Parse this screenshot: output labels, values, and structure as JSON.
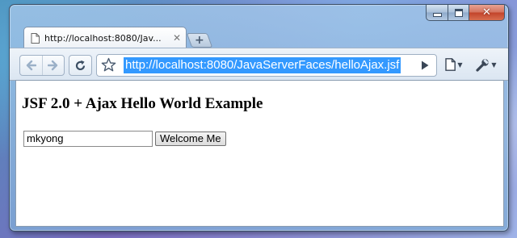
{
  "window": {
    "caption_buttons": {
      "minimize_icon": "minimize-icon",
      "maximize_icon": "maximize-icon",
      "close_icon": "close-icon"
    }
  },
  "tabs": [
    {
      "title": "http://localhost:8080/Jav...",
      "close_glyph": "✕",
      "icon": "page-icon"
    }
  ],
  "new_tab_glyph": "+",
  "toolbar": {
    "back_icon": "back-arrow-icon",
    "forward_icon": "forward-arrow-icon",
    "reload_icon": "reload-icon",
    "bookmark_icon": "star-icon",
    "url": "http://localhost:8080/JavaServerFaces/helloAjax.jsf",
    "go_icon": "play-icon",
    "page_menu_icon": "page-menu-icon",
    "tools_menu_icon": "wrench-icon"
  },
  "page": {
    "heading": "JSF 2.0 + Ajax Hello World Example",
    "name_input_value": "mkyong",
    "button_label": "Welcome Me"
  },
  "colors": {
    "selection": "#3399ff",
    "close_button": "#c2432a"
  }
}
